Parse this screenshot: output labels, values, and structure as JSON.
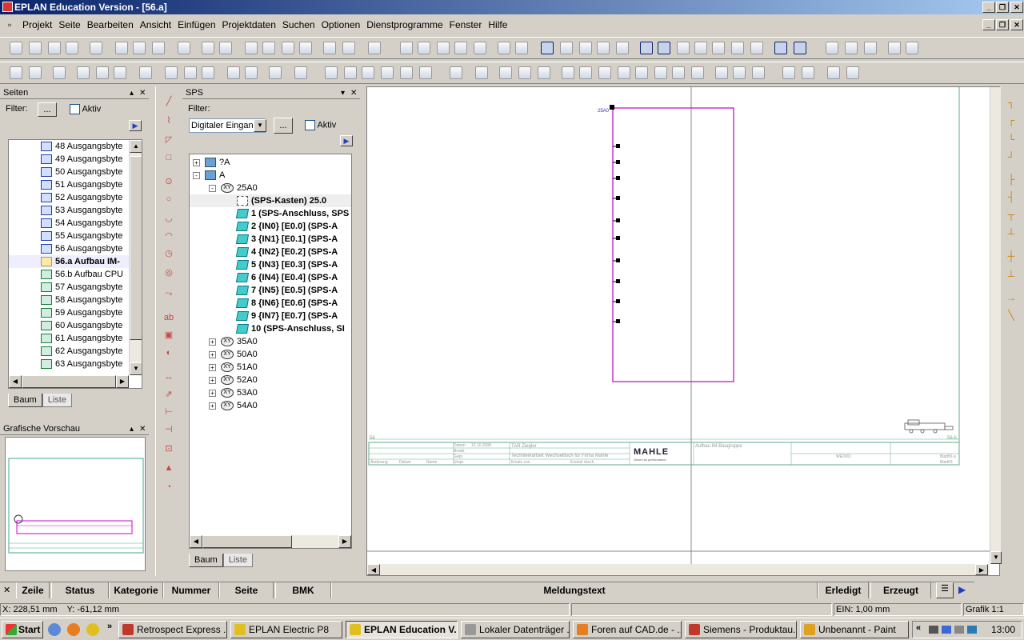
{
  "window": {
    "title": "EPLAN Education Version - [56.a]"
  },
  "menu": [
    "Projekt",
    "Seite",
    "Bearbeiten",
    "Ansicht",
    "Einfügen",
    "Projektdaten",
    "Suchen",
    "Optionen",
    "Dienstprogramme",
    "Fenster",
    "Hilfe"
  ],
  "pages_panel": {
    "title": "Seiten",
    "filter_label": "Filter:",
    "filter_button": "...",
    "active_label": "Aktiv",
    "items": [
      {
        "label": "48 Ausgangsbyte",
        "type": "out"
      },
      {
        "label": "49 Ausgangsbyte",
        "type": "out"
      },
      {
        "label": "50 Ausgangsbyte",
        "type": "out"
      },
      {
        "label": "51 Ausgangsbyte",
        "type": "out"
      },
      {
        "label": "52 Ausgangsbyte",
        "type": "out"
      },
      {
        "label": "53 Ausgangsbyte",
        "type": "out"
      },
      {
        "label": "54 Ausgangsbyte",
        "type": "out"
      },
      {
        "label": "55 Ausgangsbyte",
        "type": "out"
      },
      {
        "label": "56 Ausgangsbyte",
        "type": "out"
      },
      {
        "label": "56.a Aufbau IM-",
        "type": "layout",
        "selected": true
      },
      {
        "label": "56.b Aufbau CPU",
        "type": "schematic"
      },
      {
        "label": "57 Ausgangsbyte",
        "type": "schematic"
      },
      {
        "label": "58 Ausgangsbyte",
        "type": "schematic"
      },
      {
        "label": "59 Ausgangsbyte",
        "type": "schematic"
      },
      {
        "label": "60 Ausgangsbyte",
        "type": "schematic"
      },
      {
        "label": "61 Ausgangsbyte",
        "type": "schematic"
      },
      {
        "label": "62 Ausgangsbyte",
        "type": "schematic"
      },
      {
        "label": "63 Ausgangsbyte",
        "type": "schematic"
      }
    ],
    "tab_tree": "Baum",
    "tab_list": "Liste"
  },
  "preview_panel": {
    "title": "Grafische Vorschau"
  },
  "sps_panel": {
    "title": "SPS",
    "filter_label": "Filter:",
    "filter_value": "Digitaler Eingang",
    "filter_button": "...",
    "active_label": "Aktiv",
    "tree": [
      {
        "label": "?A",
        "level": 0,
        "icon": "book",
        "expander": "+"
      },
      {
        "label": "A",
        "level": 0,
        "icon": "book",
        "expander": "-"
      },
      {
        "label": "25A0",
        "level": 1,
        "icon": "xy",
        "expander": "-"
      },
      {
        "label": "(SPS-Kasten) 25.0",
        "level": 2,
        "icon": "page",
        "bold": true,
        "selected": true
      },
      {
        "label": "1 (SPS-Anschluss, SPS",
        "level": 2,
        "icon": "cube",
        "bold": true
      },
      {
        "label": "2 {IN0} [E0.0] (SPS-A",
        "level": 2,
        "icon": "cube",
        "bold": true
      },
      {
        "label": "3 {IN1} [E0.1] (SPS-A",
        "level": 2,
        "icon": "cube",
        "bold": true
      },
      {
        "label": "4 {IN2} [E0.2] (SPS-A",
        "level": 2,
        "icon": "cube",
        "bold": true
      },
      {
        "label": "5 {IN3} [E0.3] (SPS-A",
        "level": 2,
        "icon": "cube",
        "bold": true
      },
      {
        "label": "6 {IN4} [E0.4] (SPS-A",
        "level": 2,
        "icon": "cube",
        "bold": true
      },
      {
        "label": "7 {IN5} [E0.5] (SPS-A",
        "level": 2,
        "icon": "cube",
        "bold": true
      },
      {
        "label": "8 {IN6} [E0.6] (SPS-A",
        "level": 2,
        "icon": "cube",
        "bold": true
      },
      {
        "label": "9 {IN7} [E0.7] (SPS-A",
        "level": 2,
        "icon": "cube",
        "bold": true
      },
      {
        "label": "10 (SPS-Anschluss, SI",
        "level": 2,
        "icon": "cube",
        "bold": true
      },
      {
        "label": "35A0",
        "level": 1,
        "icon": "xy",
        "expander": "+"
      },
      {
        "label": "50A0",
        "level": 1,
        "icon": "xy",
        "expander": "+"
      },
      {
        "label": "51A0",
        "level": 1,
        "icon": "xy",
        "expander": "+"
      },
      {
        "label": "52A0",
        "level": 1,
        "icon": "xy",
        "expander": "+"
      },
      {
        "label": "53A0",
        "level": 1,
        "icon": "xy",
        "expander": "+"
      },
      {
        "label": "54A0",
        "level": 1,
        "icon": "xy",
        "expander": "+"
      }
    ],
    "tab_tree": "Baum",
    "tab_list": "Liste"
  },
  "drawing": {
    "box_label": "25A0",
    "page_left": "56",
    "page_right": "56.b",
    "title_block": {
      "company": "MAHLE",
      "slogan": "Driven by performance",
      "description": "Technikerarbeit Wechseltisch für Firma Mahle",
      "page_title": "Aufbau IM-Baugruppe",
      "author": "TAR Ziegler",
      "date": "12.10.2008",
      "labels": [
        "Datum",
        "Bearb.",
        "Gepr.",
        "Änderung",
        "Datum",
        "Name",
        "Urspr.",
        "Ersatz von",
        "Ersetzt durch",
        "Blatt",
        "Blatt"
      ],
      "sheet_no": "56.a",
      "sheet_count": "63",
      "drawing_no": "WE0001"
    }
  },
  "messages": {
    "columns": [
      "Zeile",
      "Status",
      "Kategorie",
      "Nummer",
      "Seite",
      "BMK",
      "Meldungstext",
      "Erledigt",
      "Erzeugt"
    ]
  },
  "statusbar": {
    "coords_x": "X: 228,51 mm",
    "coords_y": "Y: -61,12 mm",
    "grid": "EIN: 1,00 mm",
    "zoom": "Grafik 1:1"
  },
  "taskbar": {
    "start": "Start",
    "items": [
      {
        "label": "Retrospect Express ...",
        "color": "#c0392b"
      },
      {
        "label": "EPLAN Electric P8",
        "color": "#e0c020"
      },
      {
        "label": "EPLAN Education V...",
        "color": "#e0c020",
        "active": true
      },
      {
        "label": "Lokaler Datenträger ...",
        "color": "#999"
      },
      {
        "label": "Foren auf CAD.de - ...",
        "color": "#e67e22"
      },
      {
        "label": "Siemens - Produktau...",
        "color": "#c0392b"
      },
      {
        "label": "Unbenannt - Paint",
        "color": "#e0a020"
      }
    ],
    "clock": "13:00"
  }
}
